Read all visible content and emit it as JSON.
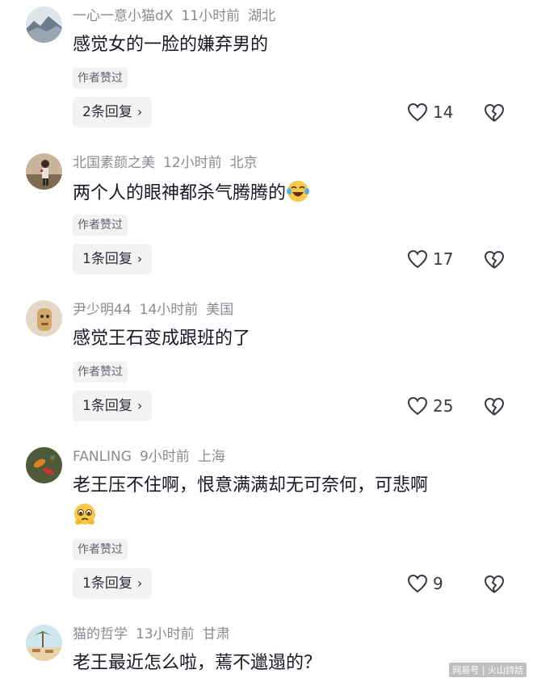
{
  "comments": [
    {
      "user": "一心一意小猫dX",
      "time": "11小时前",
      "location": "湖北",
      "text": "感觉女的一脸的嫌弃男的",
      "tag": "作者赞过",
      "reply": "2条回复",
      "likes": "14",
      "avatar": "landscape-avatar"
    },
    {
      "user": "北国素颜之美",
      "time": "12小时前",
      "location": "北京",
      "text": "两个人的眼神都杀气腾腾的",
      "emoji": "laughing-tears-emoji",
      "tag": "作者赞过",
      "reply": "1条回复",
      "likes": "17",
      "avatar": "person-avatar"
    },
    {
      "user": "尹少明44",
      "time": "14小时前",
      "location": "美国",
      "text": "感觉王石变成跟班的了",
      "tag": "作者赞过",
      "reply": "1条回复",
      "likes": "25",
      "avatar": "cartoon-avatar"
    },
    {
      "user": "FANLING",
      "time": "9小时前",
      "location": "上海",
      "text": "老王压不住啊，恨意满满却无可奈何，可悲啊",
      "emoji": "pleading-emoji",
      "tag": "作者赞过",
      "reply": "1条回复",
      "likes": "9",
      "avatar": "koi-avatar"
    },
    {
      "user": "猫的哲学",
      "time": "13小时前",
      "location": "甘肃",
      "text": "老王最近怎么啦，蔫不邋遢的？",
      "avatar": "beach-avatar"
    }
  ],
  "icons": {
    "like": "heart-icon",
    "dislike": "broken-heart-icon",
    "chevron": "›"
  },
  "watermark": "网易号 | 火山詩話",
  "colors": {
    "text": "#161823",
    "meta": "#8a8b91",
    "pill_bg": "#f3f3f4"
  }
}
